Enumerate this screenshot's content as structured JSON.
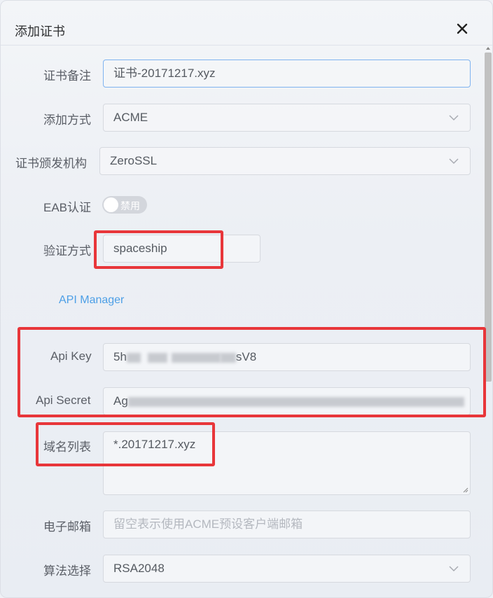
{
  "dialog": {
    "title": "添加证书"
  },
  "form": {
    "remark": {
      "label": "证书备注",
      "value": "证书-20171217.xyz"
    },
    "add_method": {
      "label": "添加方式",
      "value": "ACME"
    },
    "issuer": {
      "label": "证书颁发机构",
      "value": "ZeroSSL"
    },
    "eab": {
      "label": "EAB认证",
      "toggle_text": "禁用",
      "enabled": false
    },
    "verify_method": {
      "label": "验证方式",
      "value": "spaceship"
    },
    "api_manager_link": "API Manager",
    "api_key": {
      "label": "Api Key",
      "value_start": "5h",
      "value_end": "sV8"
    },
    "api_secret": {
      "label": "Api Secret",
      "value_start": "Ag"
    },
    "domains": {
      "label": "域名列表",
      "value": "*.20171217.xyz"
    },
    "email": {
      "label": "电子邮箱",
      "placeholder": "留空表示使用ACME预设客户端邮箱"
    },
    "algorithm": {
      "label": "算法选择",
      "value": "RSA2048"
    }
  },
  "colors": {
    "highlight": "#e8363a",
    "link": "#4d9fe6"
  },
  "icons": [
    "close-icon",
    "chevron-down-icon",
    "resize-handle-icon"
  ]
}
